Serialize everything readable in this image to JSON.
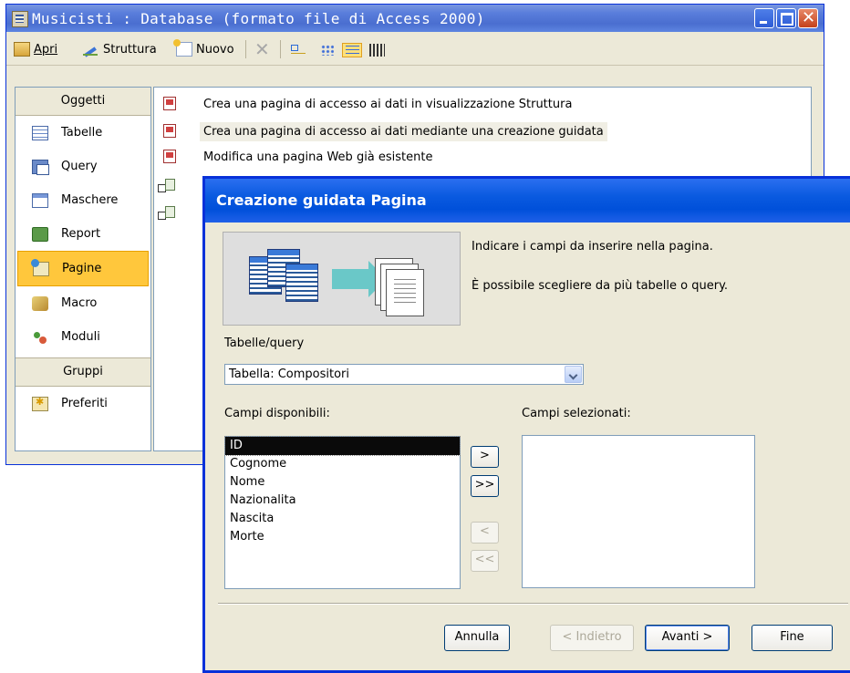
{
  "db_window": {
    "title": "Musicisti : Database (formato file di Access 2000)",
    "toolbar": {
      "open": "Apri",
      "design": "Struttura",
      "new": "Nuovo"
    },
    "objects_header": "Oggetti",
    "objects": [
      {
        "label": "Tabelle",
        "icon": "table-icon"
      },
      {
        "label": "Query",
        "icon": "query-icon"
      },
      {
        "label": "Maschere",
        "icon": "form-icon"
      },
      {
        "label": "Report",
        "icon": "report-icon"
      },
      {
        "label": "Pagine",
        "icon": "page-icon",
        "selected": true
      },
      {
        "label": "Macro",
        "icon": "macro-icon"
      },
      {
        "label": "Moduli",
        "icon": "module-icon"
      }
    ],
    "groups_header": "Gruppi",
    "groups": [
      {
        "label": "Preferiti",
        "icon": "favorites-icon"
      }
    ],
    "list_items": [
      "Crea una pagina di accesso ai dati in visualizzazione Struttura",
      "Crea una pagina di accesso ai dati mediante una creazione guidata",
      "Modifica una pagina Web già esistente"
    ]
  },
  "wizard": {
    "title": "Creazione guidata Pagina",
    "instruction1": "Indicare i campi da inserire nella pagina.",
    "instruction2": "È possibile scegliere da più tabelle o query.",
    "tables_label": "Tabelle/query",
    "tables_value": "Tabella: Compositori",
    "available_label": "Campi disponibili:",
    "selected_label": "Campi selezionati:",
    "available_fields": [
      "ID",
      "Cognome",
      "Nome",
      "Nazionalita",
      "Nascita",
      "Morte"
    ],
    "move": {
      "one": ">",
      "all": ">>",
      "back_one": "<",
      "back_all": "<<"
    },
    "buttons": {
      "cancel": "Annulla",
      "back": "< Indietro",
      "next": "Avanti >",
      "finish": "Fine"
    }
  },
  "colors": {
    "xp_blue": "#0831d9",
    "selection_orange": "#ffc73c",
    "window_face": "#ece9d8"
  }
}
